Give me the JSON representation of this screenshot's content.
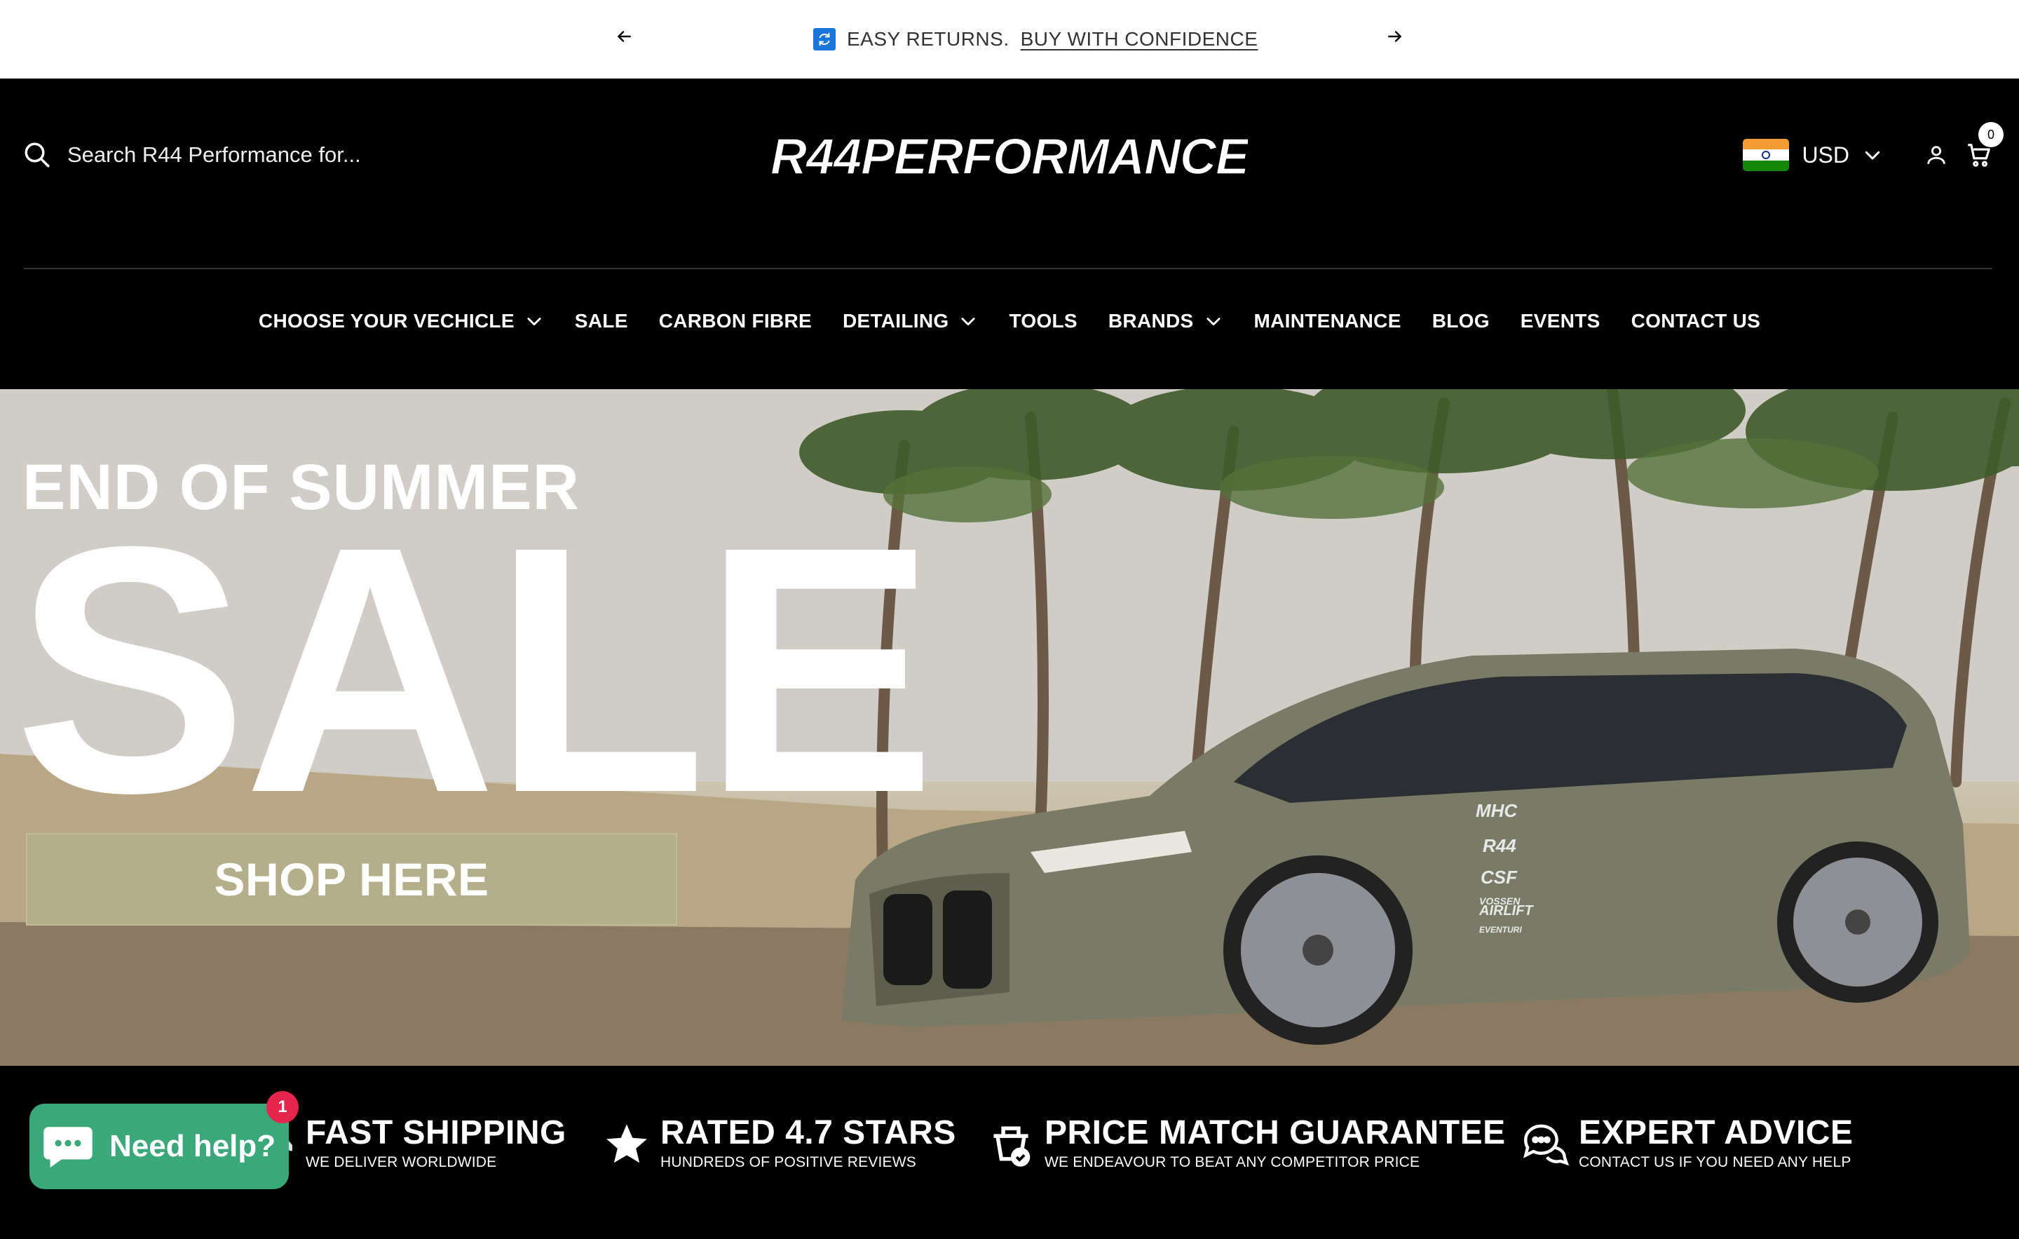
{
  "announcement": {
    "text": "EASY RETURNS.",
    "link": "BUY WITH CONFIDENCE",
    "prev_icon": "arrow-left-icon",
    "next_icon": "arrow-right-icon",
    "message_icon": "returns-icon"
  },
  "header": {
    "search_placeholder": "Search R44 Performance for...",
    "logo_text": "R44PERFORMANCE",
    "currency": "USD",
    "cart_count": "0"
  },
  "nav": [
    {
      "label": "CHOOSE YOUR VECHICLE",
      "dropdown": true
    },
    {
      "label": "SALE",
      "dropdown": false
    },
    {
      "label": "CARBON FIBRE",
      "dropdown": false
    },
    {
      "label": "DETAILING",
      "dropdown": true
    },
    {
      "label": "TOOLS",
      "dropdown": false
    },
    {
      "label": "BRANDS",
      "dropdown": true
    },
    {
      "label": "MAINTENANCE",
      "dropdown": false
    },
    {
      "label": "BLOG",
      "dropdown": false
    },
    {
      "label": "EVENTS",
      "dropdown": false
    },
    {
      "label": "CONTACT US",
      "dropdown": false
    }
  ],
  "hero": {
    "pretitle": "END OF SUMMER",
    "title": "SALE",
    "cta": "SHOP HERE",
    "car_decals": [
      "MHC",
      "R44",
      "CSF",
      "VOSSEN",
      "AIRLIFT",
      "EVENTURI"
    ]
  },
  "features": [
    {
      "title": "FAST SHIPPING",
      "subtitle": "WE DELIVER WORLDWIDE",
      "icon": "truck-icon"
    },
    {
      "title": "RATED 4.7 STARS",
      "subtitle": "HUNDREDS OF POSITIVE REVIEWS",
      "icon": "star-icon"
    },
    {
      "title": "PRICE MATCH GUARANTEE",
      "subtitle": "WE ENDEAVOUR TO BEAT ANY COMPETITOR PRICE",
      "icon": "price-tag-icon"
    },
    {
      "title": "EXPERT ADVICE",
      "subtitle": "CONTACT US IF YOU NEED ANY HELP",
      "icon": "chat-bubbles-icon"
    }
  ],
  "chat": {
    "label": "Need help?",
    "badge": "1"
  },
  "colors": {
    "header_bg": "#000000",
    "cta_bg": "#b5ae8a",
    "chat_bg": "#3aa879",
    "badge": "#e5254c"
  }
}
